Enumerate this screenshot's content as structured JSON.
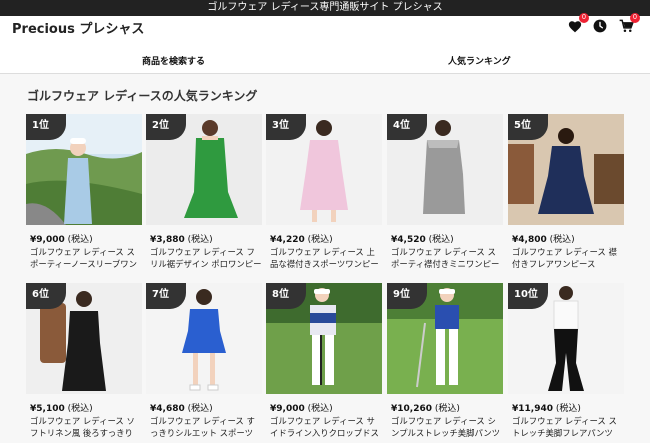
{
  "topbar": {
    "text": "ゴルフウェア レディース専門通販サイト プレシャス"
  },
  "header": {
    "logo": "Precious プレシャス",
    "wishlist_count": "0",
    "cart_count": "0",
    "nav": [
      {
        "label": "商品を検索する"
      },
      {
        "label": "人気ランキング"
      }
    ]
  },
  "section": {
    "title": "ゴルフウェア レディースの人気ランキング"
  },
  "tax_label": "(税込)",
  "products": [
    {
      "rank": "1位",
      "price": "¥9,000",
      "name": "ゴルフウェア レディース スポーティーノースリーブワンピース"
    },
    {
      "rank": "2位",
      "price": "¥3,880",
      "name": "ゴルフウェア レディース フリル裾デザイン ポロワンピース"
    },
    {
      "rank": "3位",
      "price": "¥4,220",
      "name": "ゴルフウェア レディース 上品な襟付きスポーツワンピース"
    },
    {
      "rank": "4位",
      "price": "¥4,520",
      "name": "ゴルフウェア レディース スポーティ襟付きミニワンピース"
    },
    {
      "rank": "5位",
      "price": "¥4,800",
      "name": "ゴルフウェア レディース 襟付きフレアワンピース"
    },
    {
      "rank": "6位",
      "price": "¥5,100",
      "name": "ゴルフウェア レディース ソフトリネン風 後ろすっきり"
    },
    {
      "rank": "7位",
      "price": "¥4,680",
      "name": "ゴルフウェア レディース すっきりシルエット スポーツ"
    },
    {
      "rank": "8位",
      "price": "¥9,000",
      "name": "ゴルフウェア レディース サイドライン入りクロップドス"
    },
    {
      "rank": "9位",
      "price": "¥10,260",
      "name": "ゴルフウェア レディース シンプルストレッチ美脚パンツ"
    },
    {
      "rank": "10位",
      "price": "¥11,940",
      "name": "ゴルフウェア レディース ストレッチ美脚フレアパンツ"
    }
  ],
  "colors": {
    "topbar": "#222222",
    "badge": "#e22233",
    "rank_tag": "#333333"
  }
}
